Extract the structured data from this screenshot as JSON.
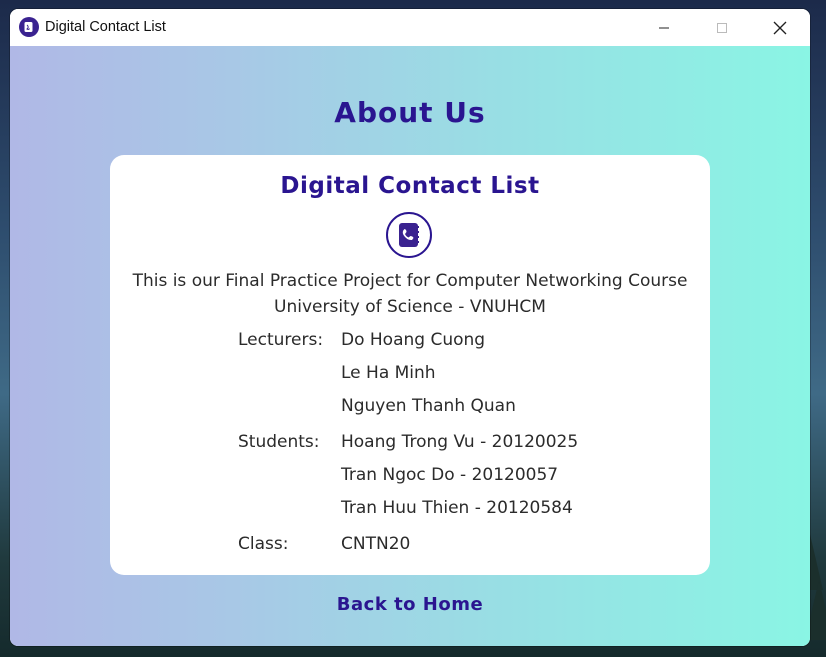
{
  "window": {
    "title": "Digital Contact List",
    "controls": {
      "minimize_icon": "minimize-icon",
      "maximize_icon": "maximize-icon",
      "close_icon": "close-icon"
    }
  },
  "page": {
    "heading": "About Us",
    "back_link": "Back to Home"
  },
  "card": {
    "title": "Digital Contact List",
    "logo_icon": "contact-book-icon",
    "description_line1": "This is our Final Practice Project for Computer Networking Course",
    "description_line2": "University of Science - VNUHCM",
    "lecturers_label": "Lecturers:",
    "lecturers": [
      "Do Hoang Cuong",
      "Le Ha Minh",
      "Nguyen Thanh Quan"
    ],
    "students_label": "Students:",
    "students": [
      "Hoang Trong Vu - 20120025",
      "Tran Ngoc Do - 20120057",
      "Tran Huu Thien - 20120584"
    ],
    "class_label": "Class:",
    "class_value": "CNTN20"
  },
  "colors": {
    "accent": "#2a1590",
    "gradient_start": "#b0b8e6",
    "gradient_end": "#8af5e4",
    "text": "#2b2b2b"
  }
}
